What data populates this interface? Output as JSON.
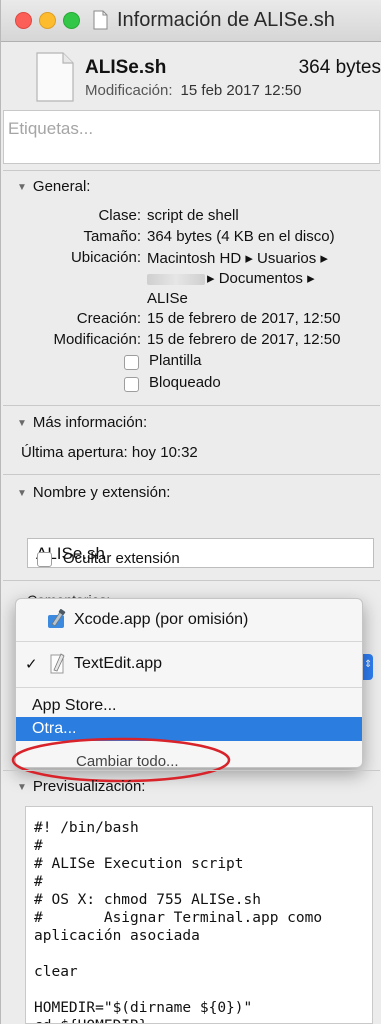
{
  "window": {
    "title": "Información de ALISe.sh"
  },
  "header": {
    "file_name": "ALISe.sh",
    "file_size": "364 bytes",
    "modified_label": "Modificación:",
    "modified_value": "15 feb 2017 12:50"
  },
  "tags": {
    "placeholder": "Etiquetas..."
  },
  "general": {
    "title": "General:",
    "clase_label": "Clase:",
    "clase_value": "script de shell",
    "tamano_label": "Tamaño:",
    "tamano_value": "364 bytes (4 KB en el disco)",
    "ubicacion_label": "Ubicación:",
    "ubicacion_line1": "Macintosh HD ▸ Usuarios ▸",
    "ubicacion_line2": "▸ Documentos ▸",
    "ubicacion_line3": "ALISe",
    "creacion_label": "Creación:",
    "creacion_value": "15 de febrero de 2017, 12:50",
    "modificacion_label": "Modificación:",
    "modificacion_value": "15 de febrero de 2017, 12:50",
    "plantilla_label": "Plantilla",
    "bloqueado_label": "Bloqueado"
  },
  "mas_info": {
    "title": "Más información:",
    "ultima_apertura": "Última apertura: hoy 10:32"
  },
  "nombre_ext": {
    "title": "Nombre y extensión:",
    "name_value": "ALISe.sh",
    "ocultar_label": "Ocultar extensión"
  },
  "comentarios": {
    "title": "Comentarios:"
  },
  "open_with_menu": {
    "items": [
      {
        "label": "Xcode.app (por omisión)"
      },
      {
        "label": "TextEdit.app",
        "checked": true
      },
      {
        "label": "App Store..."
      },
      {
        "label": "Otra..."
      }
    ],
    "check_mark": "✓",
    "partial_button": "Cambiar todo..."
  },
  "preview": {
    "title": "Previsualización:",
    "code": "#! /bin/bash\n#\n# ALISe Execution script\n#\n# OS X: chmod 755 ALISe.sh\n#       Asignar Terminal.app como\naplicación asociada\n\nclear\n\nHOMEDIR=\"$(dirname ${0})\"\ncd ${HOMEDIR}"
  },
  "colors": {
    "highlight": "#2b7de0",
    "annotation": "#d8232a"
  }
}
